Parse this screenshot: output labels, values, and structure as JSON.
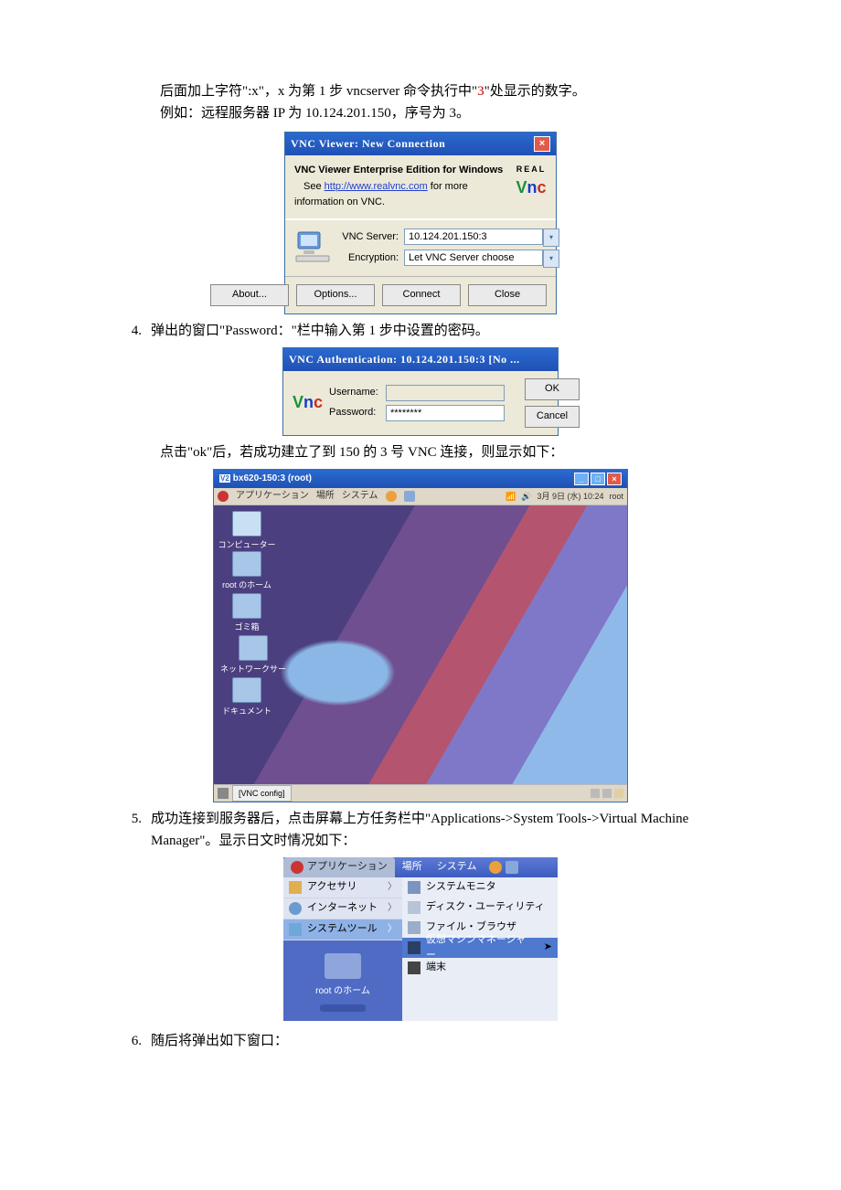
{
  "intro": {
    "line1a": "后面加上字符\":x\"，x 为第 1 步 vncserver 命令执行中\"",
    "line1_red": "3",
    "line1b": "\"处显示的数字。",
    "line2": "例如：远程服务器 IP 为 10.124.201.150，序号为 3。"
  },
  "vnc_conn": {
    "title": "VNC Viewer: New Connection",
    "hdr_bold": "VNC Viewer Enterprise Edition for Windows",
    "hdr_pre": "See ",
    "hdr_link": "http://www.realvnc.com",
    "hdr_post": " for more information on VNC.",
    "server_label": "VNC Server:",
    "server_value": "10.124.201.150:3",
    "enc_label": "Encryption:",
    "enc_value": "Let VNC Server choose",
    "btn_about": "About...",
    "btn_options": "Options...",
    "btn_connect": "Connect",
    "btn_close": "Close"
  },
  "step4": {
    "num": "4.",
    "text": "弹出的窗口\"Password：\"栏中输入第 1 步中设置的密码。"
  },
  "vnc_auth": {
    "title": "VNC Authentication: 10.124.201.150:3 [No ...",
    "user_label": "Username:",
    "user_value": "",
    "pass_label": "Password:",
    "pass_value": "********",
    "btn_ok": "OK",
    "btn_cancel": "Cancel"
  },
  "after_ok": "点击\"ok\"后，若成功建立了到 150 的 3 号 VNC 连接，则显示如下：",
  "desktop": {
    "outer_title": "bx620-150:3 (root)",
    "menu_app": "アプリケーション",
    "menu_places": "場所",
    "menu_system": "システム",
    "clock": "3月 9日 (水) 10:24",
    "user": "root",
    "icons": [
      "コンピューター",
      "root のホーム",
      "ゴミ箱",
      "ネットワークサーバー",
      "ドキュメント"
    ],
    "task": "[VNC config]"
  },
  "step5": {
    "num": "5.",
    "text": "成功连接到服务器后，点击屏幕上方任务栏中\"Applications->System Tools->Virtual Machine Manager\"。显示日文时情况如下："
  },
  "menu": {
    "top_sel": "アプリケーション",
    "top_places": "場所",
    "top_system": "システム",
    "col1": [
      {
        "label": "アクセサリ",
        "arrow": true
      },
      {
        "label": "インターネット",
        "arrow": true
      },
      {
        "label": "システムツール",
        "arrow": true,
        "sel": true
      }
    ],
    "launcher_label": "root のホーム",
    "col2": [
      {
        "label": "システムモニタ"
      },
      {
        "label": "ディスク・ユーティリティ"
      },
      {
        "label": "ファイル・ブラウザ"
      },
      {
        "label": "仮想マシンマネージャー",
        "sel": true
      },
      {
        "label": "端末"
      }
    ]
  },
  "step6": {
    "num": "6.",
    "text": "随后将弹出如下窗口："
  }
}
